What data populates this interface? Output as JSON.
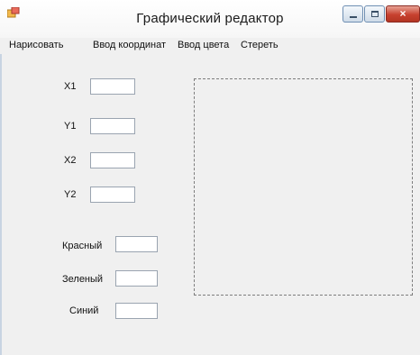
{
  "window": {
    "title": "Графический редактор",
    "close_glyph": "×",
    "icons": {
      "app": "app-icon",
      "minimize": "minimize-icon",
      "maximize": "maximize-icon",
      "close": "close-icon"
    }
  },
  "menu": {
    "items": [
      {
        "label": "Нарисовать"
      },
      {
        "label": "Ввод координат"
      },
      {
        "label": "Ввод цвета"
      },
      {
        "label": "Стереть"
      }
    ]
  },
  "form": {
    "x1": {
      "label": "X1",
      "value": ""
    },
    "y1": {
      "label": "Y1",
      "value": ""
    },
    "x2": {
      "label": "X2",
      "value": ""
    },
    "y2": {
      "label": "Y2",
      "value": ""
    },
    "red": {
      "label": "Красный",
      "value": ""
    },
    "green": {
      "label": "Зеленый",
      "value": ""
    },
    "blue": {
      "label": "Синий",
      "value": ""
    }
  },
  "colors": {
    "window_bg": "#f0f0f0",
    "close_button": "#c7412f",
    "control_border": "#6f8fb3"
  }
}
